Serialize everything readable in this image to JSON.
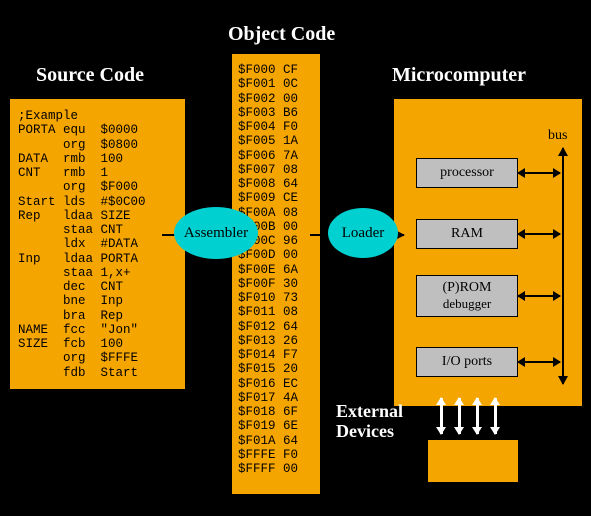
{
  "titles": {
    "source": "Source Code",
    "object": "Object Code",
    "micro": "Microcomputer"
  },
  "source_code": ";Example\nPORTA equ  $0000\n      org  $0800\nDATA  rmb  100\nCNT   rmb  1\n      org  $F000\nStart lds  #$0C00\nRep   ldaa SIZE\n      staa CNT\n      ldx  #DATA\nInp   ldaa PORTA\n      staa 1,x+\n      dec  CNT\n      bne  Inp\n      bra  Rep\nNAME  fcc  \"Jon\"\nSIZE  fcb  100\n      org  $FFFE\n      fdb  Start",
  "object_code": "$F000 CF\n$F001 0C\n$F002 00\n$F003 B6\n$F004 F0\n$F005 1A\n$F006 7A\n$F007 08\n$F008 64\n$F009 CE\n$F00A 08\n$F00B 00\n$F00C 96\n$F00D 00\n$F00E 6A\n$F00F 30\n$F010 73\n$F011 08\n$F012 64\n$F013 26\n$F014 F7\n$F015 20\n$F016 EC\n$F017 4A\n$F018 6F\n$F019 6E\n$F01A 64\n$FFFE F0\n$FFFF 00",
  "bubbles": {
    "assembler": "Assembler",
    "loader": "Loader"
  },
  "micro_boxes": {
    "processor": "processor",
    "ram": "RAM",
    "rom_line1": "(P)ROM",
    "rom_line2": "debugger",
    "io": "I/O ports"
  },
  "bus_label": "bus",
  "external_devices_line1": "External",
  "external_devices_line2": "Devices"
}
